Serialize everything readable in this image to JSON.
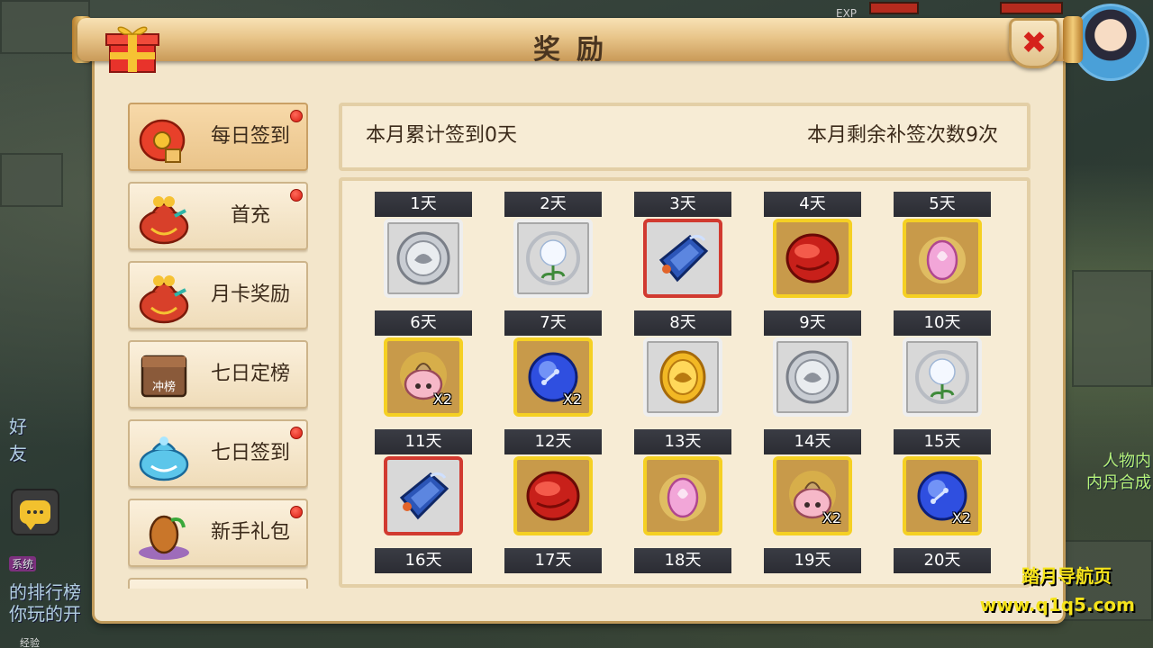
{
  "panel": {
    "title": "奖励",
    "close_label": "✖"
  },
  "sidebar": {
    "items": [
      {
        "label": "每日签到",
        "icon": "red-pouch-icon",
        "active": true,
        "has_dot": true
      },
      {
        "label": "首充",
        "icon": "treasure-bag-icon",
        "active": false,
        "has_dot": true
      },
      {
        "label": "月卡奖励",
        "icon": "treasure-bag-icon",
        "active": false,
        "has_dot": false
      },
      {
        "label": "七日定榜",
        "icon": "ranking-chest-icon",
        "icon_text": "冲榜",
        "active": false,
        "has_dot": false
      },
      {
        "label": "七日签到",
        "icon": "blue-bag-icon",
        "active": false,
        "has_dot": true
      },
      {
        "label": "新手礼包",
        "icon": "egg-gift-icon",
        "active": false,
        "has_dot": true
      },
      {
        "label": "",
        "icon": "treasure-bag-icon",
        "active": false,
        "has_dot": false
      }
    ]
  },
  "info": {
    "monthly_total": "本月累计签到0天",
    "remaining_makeup": "本月剩余补签次数9次"
  },
  "days": [
    {
      "label": "1天",
      "item": "silver-coin",
      "frame": "white",
      "qty": ""
    },
    {
      "label": "2天",
      "item": "dandelion",
      "frame": "white",
      "qty": ""
    },
    {
      "label": "3天",
      "item": "blue-token",
      "frame": "red",
      "qty": ""
    },
    {
      "label": "4天",
      "item": "red-gem",
      "frame": "gold",
      "qty": ""
    },
    {
      "label": "5天",
      "item": "pink-egg",
      "frame": "gold",
      "qty": ""
    },
    {
      "label": "6天",
      "item": "potion-bag",
      "frame": "gold",
      "qty": "X2"
    },
    {
      "label": "7天",
      "item": "blue-orb",
      "frame": "gold",
      "qty": "X2"
    },
    {
      "label": "8天",
      "item": "gold-coin",
      "frame": "white",
      "qty": ""
    },
    {
      "label": "9天",
      "item": "silver-coin",
      "frame": "white",
      "qty": ""
    },
    {
      "label": "10天",
      "item": "dandelion",
      "frame": "white",
      "qty": ""
    },
    {
      "label": "11天",
      "item": "blue-token",
      "frame": "red",
      "qty": ""
    },
    {
      "label": "12天",
      "item": "red-gem",
      "frame": "gold",
      "qty": ""
    },
    {
      "label": "13天",
      "item": "pink-egg",
      "frame": "gold",
      "qty": ""
    },
    {
      "label": "14天",
      "item": "potion-bag",
      "frame": "gold",
      "qty": "X2"
    },
    {
      "label": "15天",
      "item": "blue-orb",
      "frame": "gold",
      "qty": "X2"
    },
    {
      "label": "16天"
    },
    {
      "label": "17天"
    },
    {
      "label": "18天"
    },
    {
      "label": "19天"
    },
    {
      "label": "20天"
    }
  ],
  "background": {
    "left_texts": [
      "好",
      "友",
      "系统",
      "的排行榜",
      "你玩的开"
    ],
    "right_texts": [
      "人物内",
      "内丹合成"
    ],
    "bottom_text": "经验",
    "exp_label": "EXP"
  },
  "watermark": {
    "name": "踏月导航页",
    "url": "www.q1q5.com"
  },
  "colors": {
    "panel_bg": "#f3e6cb",
    "day_label_bg": "#2b2c33",
    "frame_gold": "#f5d023",
    "frame_red": "#d13a30",
    "red_dot": "#d81b10"
  }
}
